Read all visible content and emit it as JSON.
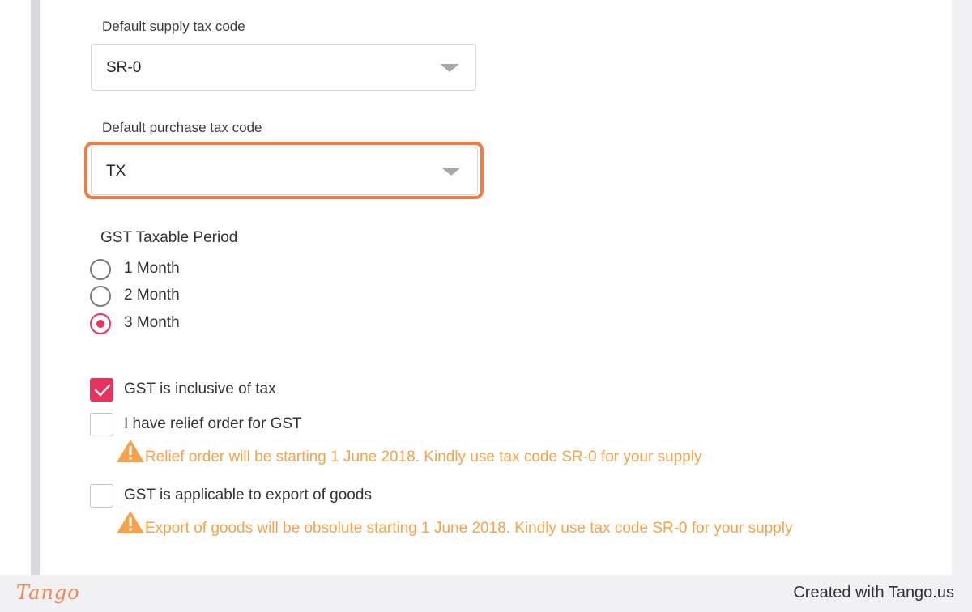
{
  "form": {
    "supply_tax": {
      "label": "Default supply tax code",
      "value": "SR-0"
    },
    "purchase_tax": {
      "label": "Default purchase tax code",
      "value": "TX"
    },
    "taxable_period": {
      "title": "GST Taxable Period",
      "options": [
        {
          "label": "1 Month",
          "selected": false
        },
        {
          "label": "2 Month",
          "selected": false
        },
        {
          "label": "3 Month",
          "selected": true
        }
      ]
    },
    "checkboxes": {
      "inclusive": {
        "label": "GST is inclusive of tax",
        "checked": true
      },
      "relief": {
        "label": "I have relief order for GST",
        "checked": false
      },
      "export": {
        "label": "GST is applicable to export of goods",
        "checked": false
      }
    },
    "warnings": {
      "relief": "Relief order will be starting 1 June 2018. Kindly use tax code SR-0 for your supply",
      "export": "Export of goods will be obsolute starting 1 June 2018. Kindly use tax code SR-0 for your supply"
    }
  },
  "footer": {
    "logo": "Tango",
    "created": "Created with Tango.us"
  },
  "colors": {
    "accent": "#e8335e",
    "highlight": "#f47a44",
    "warning": "#f5a34a"
  }
}
